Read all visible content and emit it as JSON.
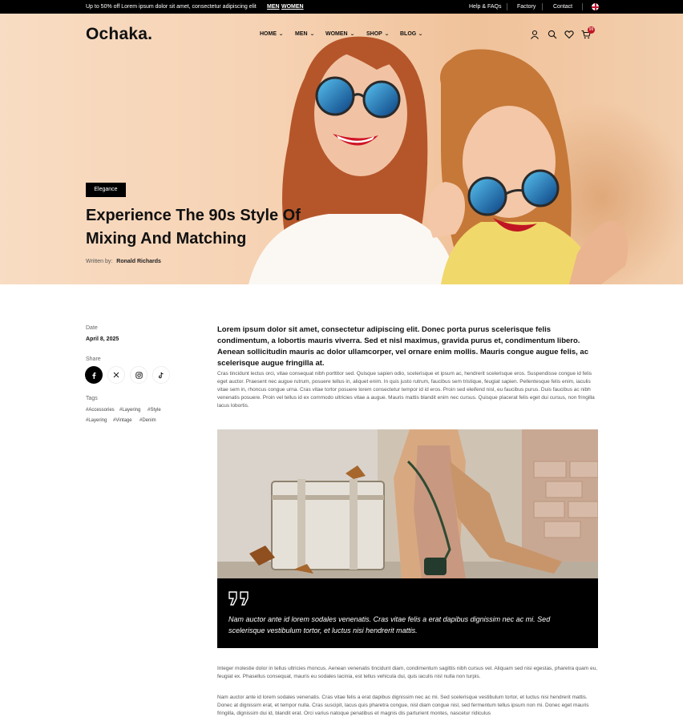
{
  "topbar": {
    "promo": "Up to 50% off Lorem ipsum dolor sit amet, consectetur adipiscing elit",
    "promo_links": [
      "MEN",
      "WOMEN"
    ],
    "links": [
      "Help & FAQs",
      "Factory",
      "Contact"
    ],
    "language_icon": "uk-flag-icon"
  },
  "header": {
    "logo": "Ochaka.",
    "nav": [
      {
        "label": "HOME"
      },
      {
        "label": "MEN"
      },
      {
        "label": "WOMEN"
      },
      {
        "label": "SHOP"
      },
      {
        "label": "BLOG"
      }
    ],
    "icons": [
      "user-icon",
      "search-icon",
      "heart-icon",
      "cart-icon"
    ],
    "cart_count": "99"
  },
  "hero": {
    "tag": "Elegance",
    "title": "Experience The 90s Style Of Mixing And Matching",
    "written_by_label": "Written by:",
    "author": "Ronald Richards"
  },
  "sidebar": {
    "date_label": "Date",
    "date_value": "April 8, 2025",
    "share_label": "Share",
    "share_icons": [
      "facebook-icon",
      "x-icon",
      "instagram-icon",
      "tiktok-icon"
    ],
    "tags_label": "Tags",
    "tags": [
      "#Accessories",
      "#Layering",
      "#Style",
      "#Layering",
      "#Vintage",
      "#Denim"
    ]
  },
  "article": {
    "lead": "Lorem ipsum dolor sit amet, consectetur adipiscing elit. Donec porta purus scelerisque felis condimentum, a lobortis mauris viverra. Sed et nisl maximus, gravida purus et, condimentum libero. Aenean sollicitudin mauris ac dolor ullamcorper, vel ornare enim mollis. Mauris congue augue felis, ac scelerisque augue fringilla at.",
    "paragraph1": "Cras tincidunt lectus orci, vitae consequat nibh porttitor sed. Quisque sapien odio, scelerisque et ipsum ac, hendrerit scelerisque eros. Suspendisse congue id felis eget auctor. Praesent nec augue rutrum, posuere tellus in, aliquet enim. In quis justo rutrum, faucibus sem tristique, feugiat sapien. Pellentesque felis enim, iaculis vitae sem in, rhoncus congue urna. Cras vitae tortor posuere lorem consectetur tempor id id eros. Proin sed eleifend nisl, eu faucibus purus. Duis faucibus ac nibh venenatis posuere. Proin vel tellus id ex commodo ultricies vitae a augue. Mauris mattis blandit enim nec cursus. Quisque placerat felis eget dui cursus, non fringilla lacus lobortis.",
    "quote": "Nam auctor ante id lorem sodales venenatis. Cras vitae felis a erat dapibus dignissim nec ac mi. Sed scelerisque vestibulum tortor, et luctus nisi hendrerit mattis.",
    "paragraph2": "Integer molestie dolor in tellus ultricies rhoncus. Aenean venenatis tincidunt diam, condimentum sagittis nibh cursus vel. Aliquam sed nisi egestas, pharetra quam eu, feugiat ex. Phasellus consequat, mauris eu sodales lacinia, est tellus vehicula dui, quis iaculis nisl nulla non turpis.",
    "paragraph3": "Nam auctor ante id lorem sodales venenatis. Cras vitae felis a erat dapibus dignissim nec ac mi. Sed scelerisque vestibulum tortor, et luctus nisi hendrerit mattis. Donec at dignissim erat, et tempor nulla. Cras suscipit, lacus quis pharetra congue, nisl diam congue nisl, sed fermentum tellus ipsum non mi. Donec eget mauris fringilla, dignissim dui id, blandit erat. Orci varius natoque penatibus et magnis dis parturient montes, nascetur ridiculus"
  },
  "colors": {
    "hero_bg": "#f6d2b3",
    "badge": "#c01623",
    "dark": "#000000"
  }
}
